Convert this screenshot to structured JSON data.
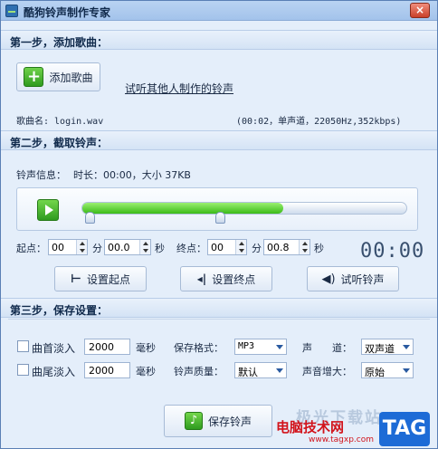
{
  "window": {
    "title": "酷狗铃声制作专家",
    "close_label": "×"
  },
  "step1": {
    "header": "第一步，添加歌曲：",
    "add_button": "添加歌曲",
    "plus_glyph": "+",
    "listen_link": "试听其他人制作的铃声",
    "song_name_label": "歌曲名: login.wav",
    "song_info": "(00:02，单声道，22050Hz,352kbps)"
  },
  "step2": {
    "header": "第二步，截取铃声：",
    "ringtone_info_label": "铃声信息：",
    "ringtone_info_value": "时长：00:00，大小 37KB",
    "progress_fraction": 0.62,
    "start_label": "起点：",
    "start_min": "00",
    "start_min_unit": "分",
    "start_sec": "00.0",
    "start_sec_unit": "秒",
    "end_label": "终点：",
    "end_min": "00",
    "end_min_unit": "分",
    "end_sec": "00.8",
    "end_sec_unit": "秒",
    "time_display": "00:00",
    "set_start_button": "设置起点",
    "set_end_button": "设置终点",
    "preview_button": "试听铃声"
  },
  "step3": {
    "header": "第三步，保存设置：",
    "fade_in_label": "曲首淡入",
    "fade_in_value": "2000",
    "fade_in_unit": "毫秒",
    "fade_out_label": "曲尾淡入",
    "fade_out_value": "2000",
    "fade_out_unit": "毫秒",
    "format_label": "保存格式：",
    "format_value": "MP3",
    "quality_label": "铃声质量：",
    "quality_value": "默认",
    "channel_label": "声　　道：",
    "channel_value": "双声道",
    "volume_label": "声音增大：",
    "volume_value": "原始",
    "save_button": "保存铃声",
    "save_glyph": "♪"
  },
  "watermark": {
    "faint_text": "极光下载站",
    "site_name": "电脑技术网",
    "url": "www.tagxp.com",
    "tag": "TAG"
  },
  "colors": {
    "accent_green": "#3bbb18",
    "tag_blue": "#1d6bd6",
    "watermark_red": "#d2131b"
  }
}
